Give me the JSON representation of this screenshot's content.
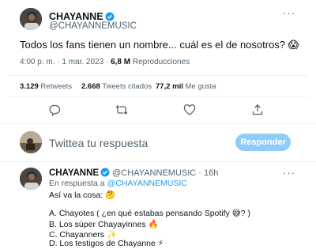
{
  "tweet": {
    "display_name": "CHAYANNE",
    "handle": "@CHAYANNEMUSIC",
    "text": "Todos los fans tienen un nombre... cuál es el de nosotros? 😱",
    "time": "4:00 p. m. · 1 mar. 2023 · ",
    "views_count": "6,8 M",
    "views_label": " Reproducciones",
    "stats": {
      "retweets_count": "3.129",
      "retweets_label": " Retweets",
      "quotes_count": "2.668",
      "quotes_label": " Tweets citados",
      "likes_count": "77,2 mil",
      "likes_label": " Me gusta"
    },
    "more_label": "···",
    "actions": [
      "reply-icon",
      "retweet-icon",
      "like-icon",
      "share-icon"
    ]
  },
  "composer": {
    "placeholder": "Twittea tu respuesta",
    "button_label": "Responder"
  },
  "reply": {
    "display_name": "CHAYANNE",
    "handle": "@CHAYANNEMUSIC",
    "age": " · 16h",
    "replying_prefix": "En respuesta a ",
    "replying_to": "@CHAYANNEMUSIC",
    "line1": "Así va la cosa: 🤔",
    "options": [
      "A. Chayotes ( ¿en qué estabas pensando Spotify 😅? )",
      "B. Los súper Chayayinnes 🔥",
      "C. Chayanners ✨",
      "D. Los testigos de Chayanne ⚡"
    ],
    "more_label": "···"
  },
  "colors": {
    "accent": "#1d9bf0",
    "button_disabled": "#8ecdf8",
    "secondary_text": "#536471",
    "verified": "#1d9bf0"
  }
}
